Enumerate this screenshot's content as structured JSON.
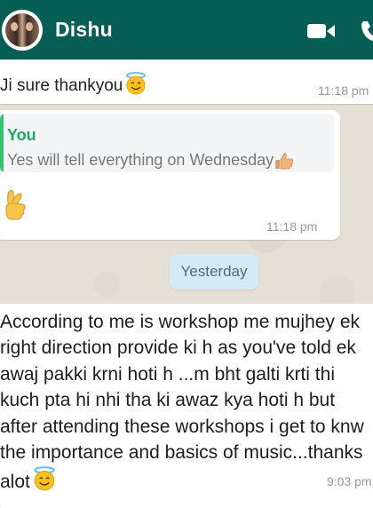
{
  "header": {
    "contact_name": "Dishu",
    "avatar_icon": "contact-avatar",
    "video_icon": "video-camera-icon",
    "call_icon": "phone-icon",
    "background_color": "#075e54"
  },
  "messages": [
    {
      "text": "Ji sure thankyou",
      "emoji": "smiling-face-with-halo",
      "time": "11:18 pm"
    },
    {
      "quote_author": "You",
      "quote_text": "Yes will tell everything on Wednesday",
      "quote_emoji": "thumbs-up",
      "emoji": "crossed-fingers",
      "time": "11:18 pm"
    },
    {
      "text": "According to me is workshop me mujhey ek right direction provide ki h as you've told ek awaj pakki krni hoti h ...m bht galti krti thi kuch pta hi nhi tha ki awaz kya hoti h but after attending these workshops i get to knw the importance and basics of music...thanks alot",
      "emoji": "smiling-face-with-halo",
      "time": "9:03 pm"
    }
  ],
  "date_separator": "Yesterday",
  "colors": {
    "quote_accent": "#35c272",
    "date_chip": "#d4eaf4",
    "bubble": "#ffffff"
  }
}
